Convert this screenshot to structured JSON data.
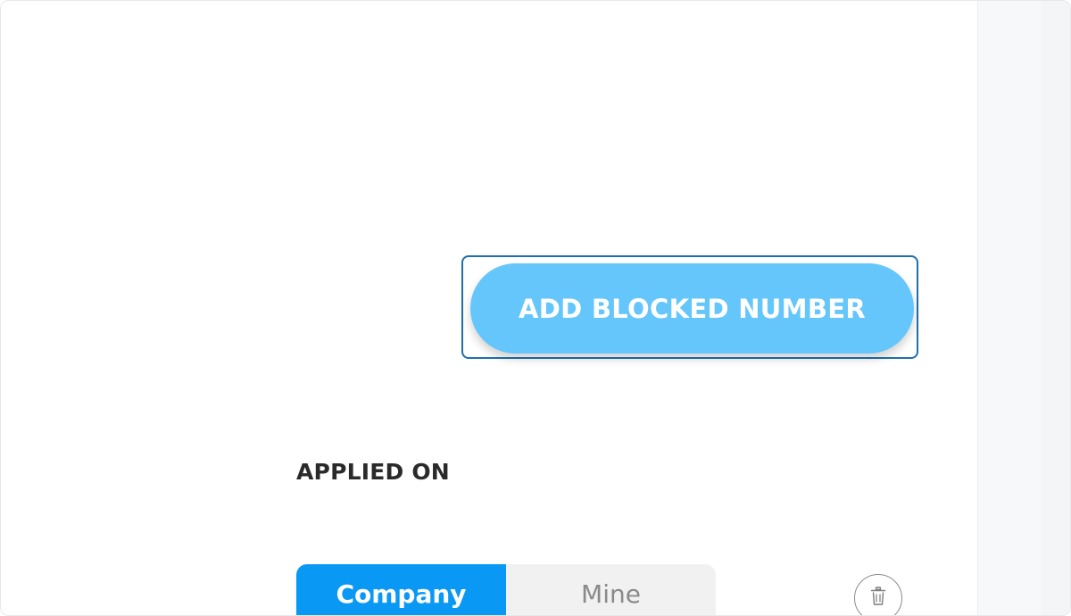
{
  "actions": {
    "add_blocked_number_label": "ADD BLOCKED NUMBER"
  },
  "applied_on": {
    "label": "APPLIED ON",
    "options": [
      {
        "label": "Company",
        "selected": true
      },
      {
        "label": "Mine",
        "selected": false
      }
    ]
  },
  "icons": {
    "delete": "trash-icon"
  },
  "colors": {
    "button_primary": "#64c6fb",
    "segment_active": "#0a98f5",
    "segment_inactive": "#f1f1f1",
    "highlight_outline": "#1f6fad"
  }
}
